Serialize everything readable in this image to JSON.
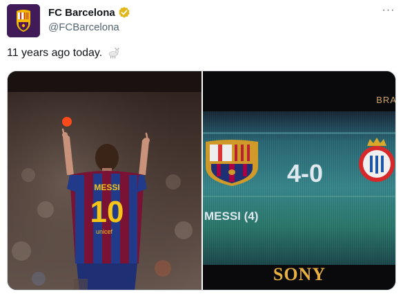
{
  "account": {
    "display_name": "FC Barcelona",
    "handle": "@FCBarcelona",
    "verified": true
  },
  "tweet": {
    "text": "11 years ago today.",
    "emoji": "goat-emoji"
  },
  "media": {
    "left_photo": {
      "jersey_name": "MESSI",
      "jersey_number": "10",
      "sponsor": "unicef"
    },
    "right_photo": {
      "score": "4-0",
      "scorer": "MESSI (4)",
      "board_brand": "SONY",
      "corner_text": "BRA"
    }
  },
  "colors": {
    "barca_blue": "#0b2a63",
    "barca_red": "#a50044",
    "gold": "#f5b700",
    "text_secondary": "#536471"
  }
}
